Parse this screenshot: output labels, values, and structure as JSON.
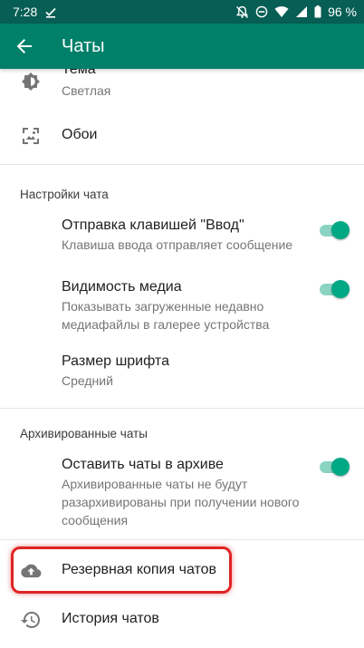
{
  "status_bar": {
    "time": "7:28",
    "battery": "96 %"
  },
  "app_bar": {
    "title": "Чаты"
  },
  "display": {
    "theme": {
      "label": "Тема",
      "value": "Светлая"
    },
    "wallpaper": {
      "label": "Обои"
    }
  },
  "chat_settings": {
    "header": "Настройки чата",
    "enter_send": {
      "label": "Отправка клавишей \"Ввод\"",
      "sub": "Клавиша ввода отправляет сообщение",
      "enabled": true
    },
    "media_visibility": {
      "label": "Видимость медиа",
      "sub": "Показывать загруженные недавно медиафайлы в галерее устройства",
      "enabled": true
    },
    "font_size": {
      "label": "Размер шрифта",
      "value": "Средний"
    }
  },
  "archived": {
    "header": "Архивированные чаты",
    "keep_archived": {
      "label": "Оставить чаты в архиве",
      "sub": "Архивированные чаты не будут разархивированы при получении нового сообщения",
      "enabled": true
    }
  },
  "backup": {
    "label": "Резервная копия чатов"
  },
  "history": {
    "label": "История чатов"
  },
  "colors": {
    "app_bar": "#008069",
    "status_bar": "#075e54",
    "toggle_on": "#00a884",
    "highlight": "#e02424"
  },
  "icons": {
    "theme": "brightness-icon",
    "wallpaper": "wallpaper-icon",
    "backup": "cloud-upload-icon",
    "history": "history-icon"
  }
}
